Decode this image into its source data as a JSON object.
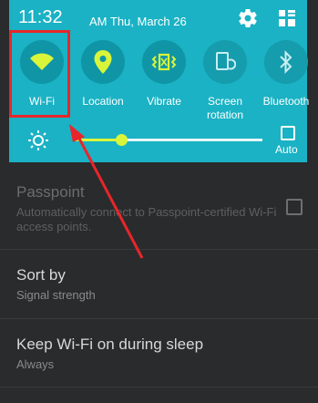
{
  "status_bar": {
    "time": "11:32",
    "meridiem_date": "AM  Thu, March 26"
  },
  "quick_settings": {
    "tiles": [
      {
        "label": "Wi-Fi",
        "icon": "wifi-icon",
        "active": true
      },
      {
        "label": "Location",
        "icon": "location-pin-icon",
        "active": true
      },
      {
        "label": "Vibrate",
        "icon": "vibrate-icon",
        "active": true
      },
      {
        "label": "Screen\nrotation",
        "icon": "screen-rotation-icon",
        "active": false
      },
      {
        "label": "Bluetooth",
        "icon": "bluetooth-icon",
        "active": false
      }
    ],
    "brightness": {
      "level": 0.25,
      "auto_label": "Auto",
      "auto_checked": false
    }
  },
  "settings_list": [
    {
      "title": "Passpoint",
      "subtitle": "Automatically connect to Passpoint-certified Wi-Fi access points.",
      "checked": false
    },
    {
      "title": "Sort by",
      "subtitle": "Signal strength"
    },
    {
      "title": "Keep Wi-Fi on during sleep",
      "subtitle": "Always"
    }
  ],
  "colors": {
    "shade": "#1ab2c4",
    "active_icon": "#d9f53a",
    "annotation": "#e8262a"
  }
}
